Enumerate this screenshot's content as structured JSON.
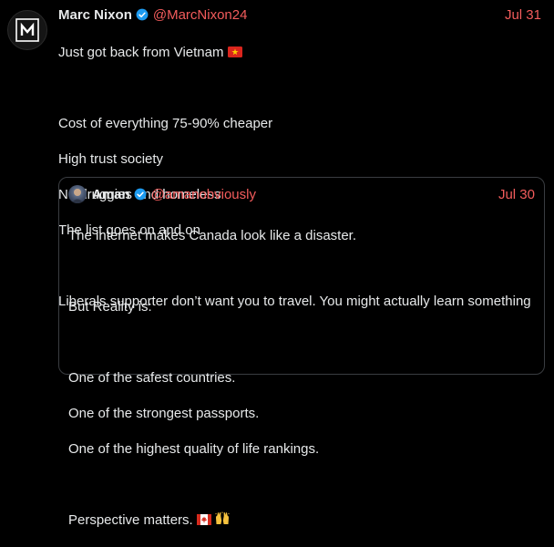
{
  "tweet": {
    "author": {
      "name": "Marc Nixon",
      "handle": "@MarcNixon24",
      "avatar_letter": "M"
    },
    "date": "Jul 31",
    "text_lines": [
      "Just got back from Vietnam",
      "",
      "Cost of everything 75-90% cheaper",
      "High trust society",
      "No druggies and homeless",
      "The list goes on and on",
      "",
      "Liberals supporter don’t want you to travel. You might actually learn something"
    ],
    "flag_emoji": "vietnam-flag"
  },
  "quote": {
    "author": {
      "name": "Aman",
      "handle": "@amanobviously"
    },
    "date": "Jul 30",
    "text_lines": [
      "The internet makes Canada look like a disaster.",
      "",
      "But Reality is:",
      "",
      "One of the safest countries.",
      "One of the strongest passports.",
      "One of the highest quality of life rankings.",
      "",
      "Perspective matters."
    ],
    "emojis": [
      "canada-flag",
      "raising-hands"
    ]
  },
  "colors": {
    "background": "#000000",
    "text": "#e7e9ea",
    "accent": "#f35c5c",
    "verified": "#1d9bf0",
    "border": "#3a3d41"
  }
}
